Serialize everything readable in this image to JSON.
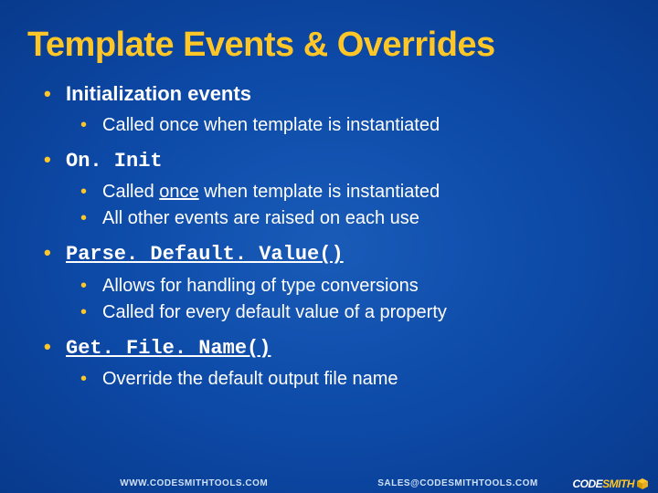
{
  "title": "Template Events & Overrides",
  "items": [
    {
      "label": "Initialization events",
      "mono": false,
      "underline": false,
      "sub": [
        {
          "text": "Called once when template is instantiated",
          "underlineWord": null
        }
      ]
    },
    {
      "label": "On. Init",
      "mono": true,
      "underline": false,
      "sub": [
        {
          "text": "Called once when template is instantiated",
          "underlineWord": "once"
        },
        {
          "text": "All other events are raised on each use",
          "underlineWord": null
        }
      ]
    },
    {
      "label": "Parse. Default. Value()",
      "mono": true,
      "underline": true,
      "sub": [
        {
          "text": "Allows for handling of type conversions",
          "underlineWord": null
        },
        {
          "text": "Called for every default value of a property",
          "underlineWord": null
        }
      ]
    },
    {
      "label": "Get. File. Name()",
      "mono": true,
      "underline": true,
      "sub": [
        {
          "text": "Override the default output file name",
          "underlineWord": null
        }
      ]
    }
  ],
  "footer": {
    "url": "WWW.CODESMITHTOOLS.COM",
    "email": "SALES@CODESMITHTOOLS.COM",
    "logoPrefix": "CODE",
    "logoSuffix": "SMITH"
  }
}
